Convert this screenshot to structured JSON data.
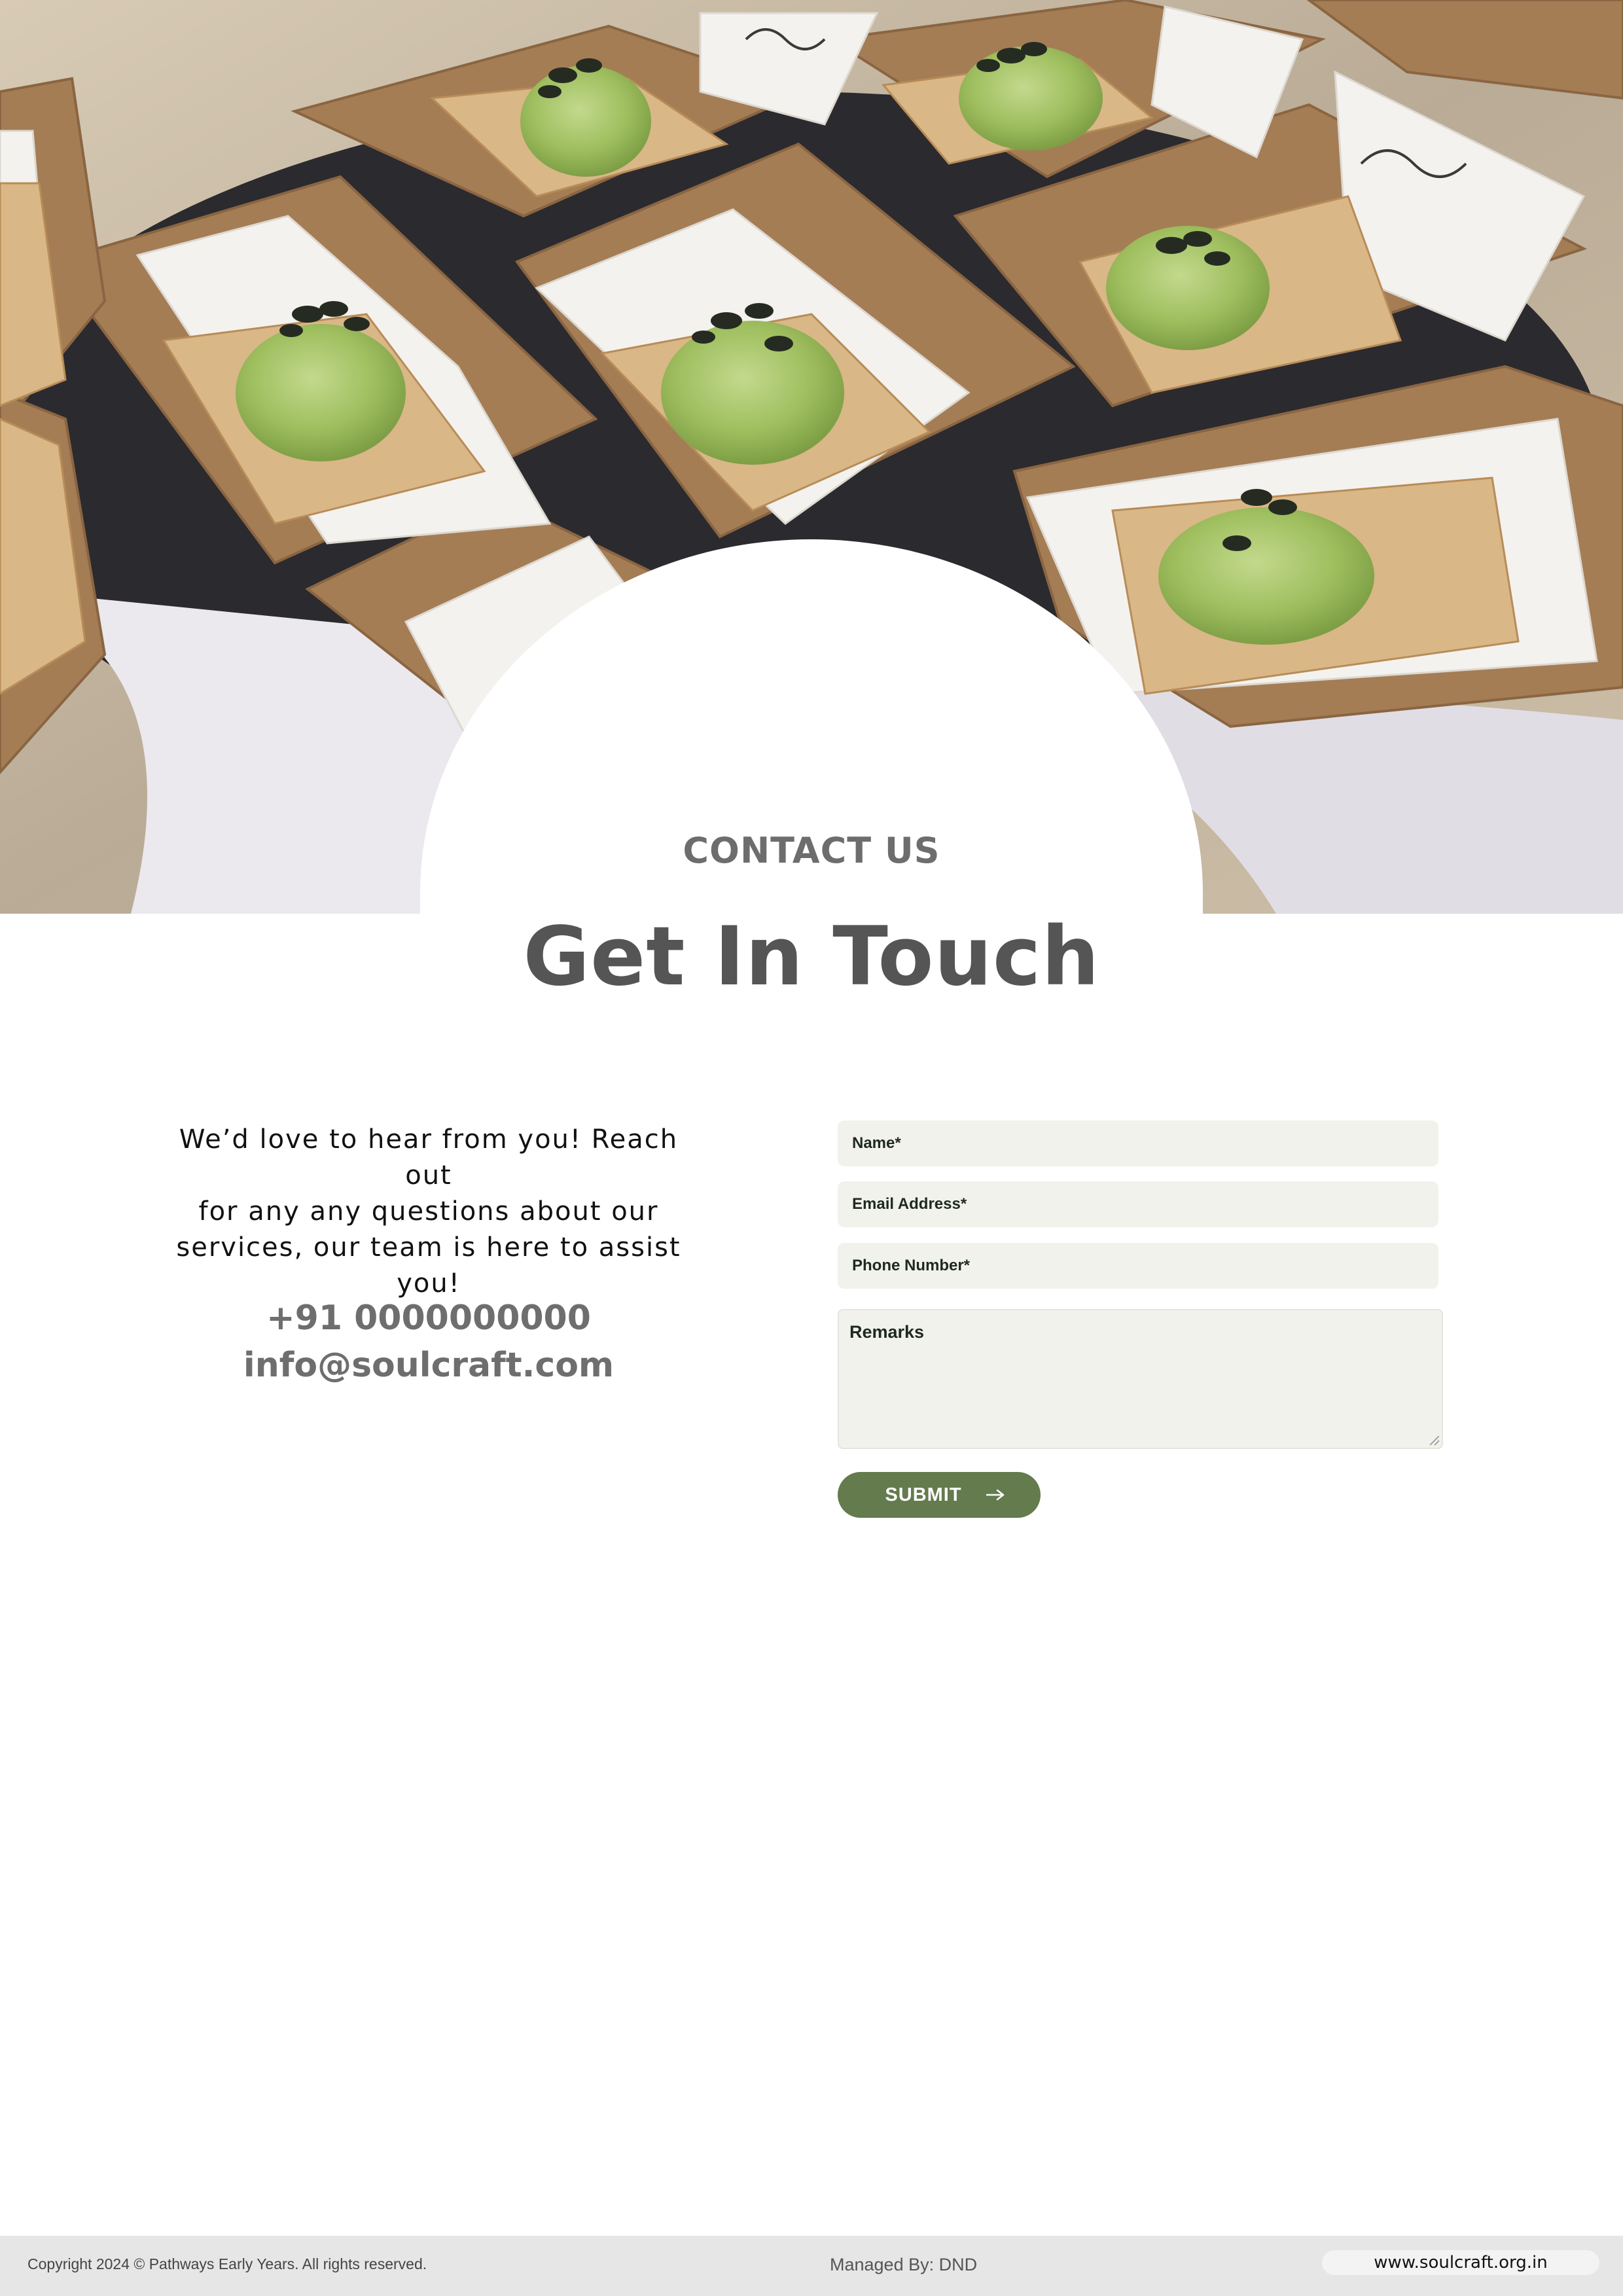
{
  "hero": {
    "icon": "hero-food-image"
  },
  "header": {
    "eyebrow": "CONTACT US",
    "title": "Get In Touch"
  },
  "info": {
    "intro_line1": "We’d love to hear from you! Reach out",
    "intro_line2": "for any  any questions about our",
    "intro_line3": "services, our team is here to assist you!",
    "phone": "+91 0000000000",
    "email": "info@soulcraft.com"
  },
  "form": {
    "name_placeholder": "Name*",
    "email_placeholder": "Email Address*",
    "phone_placeholder": "Phone Number*",
    "remarks_placeholder": "Remarks",
    "submit_label": "SUBMIT",
    "submit_icon": "arrow-right-icon"
  },
  "footer": {
    "copyright": "Copyright 2024 © Pathways Early Years. All rights reserved.",
    "managed_by": "Managed By: DND",
    "website": "www.soulcraft.org.in"
  },
  "colors": {
    "accent_green": "#637b4d",
    "field_bg": "#f1f2ec",
    "heading_gray": "#6d6d6d",
    "footer_bg": "#e6e6e6"
  }
}
